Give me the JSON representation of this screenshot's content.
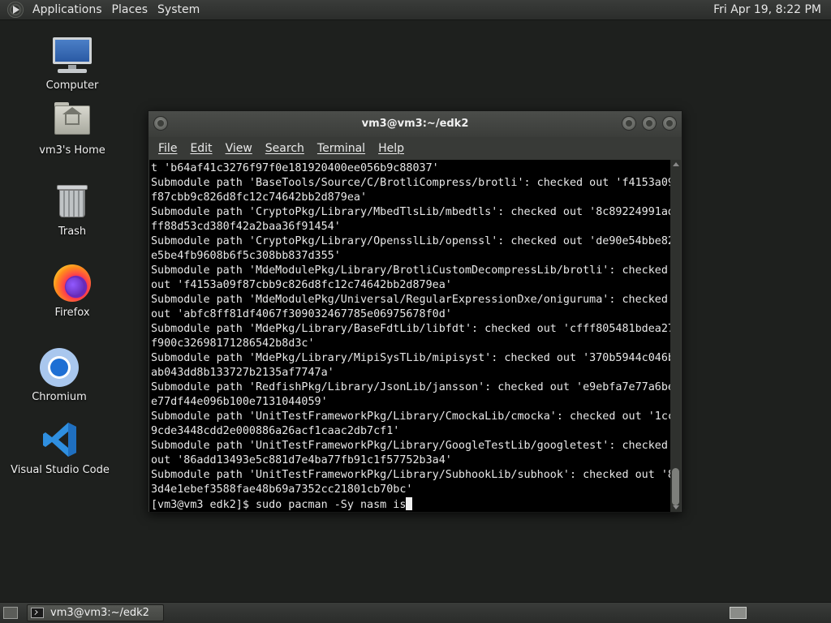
{
  "top_panel": {
    "menus": [
      "Applications",
      "Places",
      "System"
    ],
    "clock": "Fri Apr 19,  8:22 PM"
  },
  "desktop": {
    "icons": [
      {
        "label": "Computer",
        "icon": "computer-icon"
      },
      {
        "label": "vm3's Home",
        "icon": "home-folder-icon"
      },
      {
        "label": "Trash",
        "icon": "trash-icon"
      },
      {
        "label": "Firefox",
        "icon": "firefox-icon"
      },
      {
        "label": "Chromium",
        "icon": "chromium-icon"
      },
      {
        "label": "Visual Studio Code",
        "icon": "vscode-icon"
      }
    ]
  },
  "terminal": {
    "title": "vm3@vm3:~/edk2",
    "menu": [
      "File",
      "Edit",
      "View",
      "Search",
      "Terminal",
      "Help"
    ],
    "lines": [
      "t 'b64af41c3276f97f0e181920400ee056b9c88037'",
      "Submodule path 'BaseTools/Source/C/BrotliCompress/brotli': checked out 'f4153a09",
      "f87cbb9c826d8fc12c74642bb2d879ea'",
      "Submodule path 'CryptoPkg/Library/MbedTlsLib/mbedtls': checked out '8c89224991ad",
      "ff88d53cd380f42a2baa36f91454'",
      "Submodule path 'CryptoPkg/Library/OpensslLib/openssl': checked out 'de90e54bbe82",
      "e5be4fb9608b6f5c308bb837d355'",
      "Submodule path 'MdeModulePkg/Library/BrotliCustomDecompressLib/brotli': checked",
      "out 'f4153a09f87cbb9c826d8fc12c74642bb2d879ea'",
      "Submodule path 'MdeModulePkg/Universal/RegularExpressionDxe/oniguruma': checked",
      "out 'abfc8ff81df4067f309032467785e06975678f0d'",
      "Submodule path 'MdePkg/Library/BaseFdtLib/libfdt': checked out 'cfff805481bdea27",
      "f900c32698171286542b8d3c'",
      "Submodule path 'MdePkg/Library/MipiSysTLib/mipisyst': checked out '370b5944c046b",
      "ab043dd8b133727b2135af7747a'",
      "Submodule path 'RedfishPkg/Library/JsonLib/jansson': checked out 'e9ebfa7e77a6be",
      "e77df44e096b100e7131044059'",
      "Submodule path 'UnitTestFrameworkPkg/Library/CmockaLib/cmocka': checked out '1cc",
      "9cde3448cdd2e000886a26acf1caac2db7cf1'",
      "Submodule path 'UnitTestFrameworkPkg/Library/GoogleTestLib/googletest': checked",
      "out '86add13493e5c881d7e4ba77fb91c1f57752b3a4'",
      "Submodule path 'UnitTestFrameworkPkg/Library/SubhookLib/subhook': checked out '8",
      "3d4e1ebef3588fae48b69a7352cc21801cb70bc'"
    ],
    "prompt": "[vm3@vm3 edk2]$ ",
    "command": "sudo pacman -Sy nasm is"
  },
  "bottom_panel": {
    "task_label": "vm3@vm3:~/edk2"
  }
}
